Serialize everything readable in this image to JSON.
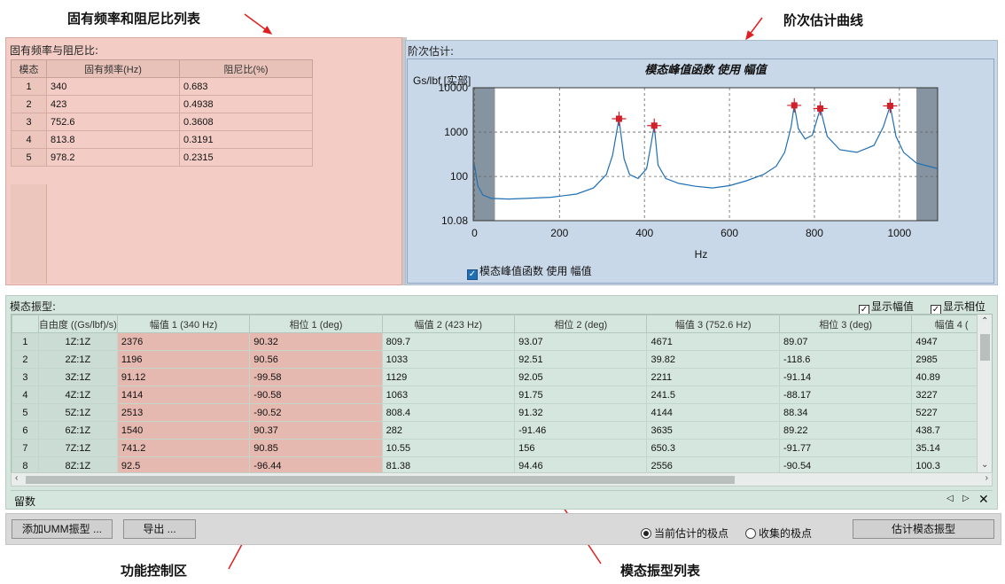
{
  "annotations": {
    "freq_table": "固有频率和阻尼比列表",
    "order_curve": "阶次估计曲线",
    "control_area": "功能控制区",
    "mode_list": "模态振型列表"
  },
  "left_panel": {
    "title": "固有频率与阻尼比:",
    "columns": [
      "模态",
      "固有频率(Hz)",
      "阻尼比(%)"
    ],
    "rows": [
      {
        "idx": "1",
        "freq": "340",
        "damp": "0.683"
      },
      {
        "idx": "2",
        "freq": "423",
        "damp": "0.4938"
      },
      {
        "idx": "3",
        "freq": "752.6",
        "damp": "0.3608"
      },
      {
        "idx": "4",
        "freq": "813.8",
        "damp": "0.3191"
      },
      {
        "idx": "5",
        "freq": "978.2",
        "damp": "0.2315"
      }
    ]
  },
  "right_panel": {
    "title": "阶次估计:",
    "legend_label": "模态峰值函数 使用 幅值"
  },
  "chart_data": {
    "type": "line",
    "title": "模态峰值函数 使用 幅值",
    "xlabel": "Hz",
    "ylabel": "Gs/lbf [实部]",
    "xlim": [
      -3,
      1090
    ],
    "ylim": [
      10.08,
      10000
    ],
    "yscale": "log",
    "x_ticks": [
      "0",
      "200",
      "400",
      "600",
      "800",
      "1000"
    ],
    "y_ticks": [
      "10000",
      "1000",
      "100",
      "10.08"
    ],
    "grid": true,
    "shaded_x_ranges": [
      [
        -3,
        48
      ],
      [
        1040,
        1090
      ]
    ],
    "series": [
      {
        "name": "模态峰值函数 使用 幅值",
        "points": [
          [
            0,
            180
          ],
          [
            8,
            60
          ],
          [
            20,
            38
          ],
          [
            40,
            32
          ],
          [
            80,
            31
          ],
          [
            120,
            32
          ],
          [
            180,
            34
          ],
          [
            240,
            40
          ],
          [
            280,
            55
          ],
          [
            310,
            110
          ],
          [
            325,
            300
          ],
          [
            340,
            2000
          ],
          [
            352,
            250
          ],
          [
            365,
            110
          ],
          [
            385,
            90
          ],
          [
            405,
            150
          ],
          [
            415,
            500
          ],
          [
            423,
            1400
          ],
          [
            432,
            180
          ],
          [
            450,
            90
          ],
          [
            480,
            70
          ],
          [
            520,
            60
          ],
          [
            560,
            55
          ],
          [
            600,
            62
          ],
          [
            640,
            80
          ],
          [
            680,
            110
          ],
          [
            710,
            170
          ],
          [
            730,
            350
          ],
          [
            745,
            1300
          ],
          [
            752.6,
            4000
          ],
          [
            762,
            1200
          ],
          [
            778,
            700
          ],
          [
            795,
            850
          ],
          [
            813.8,
            3400
          ],
          [
            830,
            800
          ],
          [
            860,
            400
          ],
          [
            900,
            350
          ],
          [
            940,
            500
          ],
          [
            962,
            1300
          ],
          [
            978.2,
            3900
          ],
          [
            992,
            800
          ],
          [
            1010,
            350
          ],
          [
            1040,
            200
          ],
          [
            1090,
            150
          ]
        ]
      }
    ],
    "peak_markers": [
      [
        340,
        2000
      ],
      [
        423,
        1400
      ],
      [
        752.6,
        4000
      ],
      [
        813.8,
        3400
      ],
      [
        978.2,
        3900
      ]
    ]
  },
  "mode_panel": {
    "title": "模态振型:",
    "show_amp": "显示幅值",
    "show_phase": "显示相位",
    "columns": [
      "",
      "自由度 ((Gs/lbf)/s)",
      "幅值 1 (340 Hz)",
      "相位 1 (deg)",
      "幅值 2 (423 Hz)",
      "相位 2 (deg)",
      "幅值 3 (752.6 Hz)",
      "相位 3 (deg)",
      "幅值 4 ("
    ],
    "rows": [
      {
        "idx": "1",
        "dof": "1Z:1Z",
        "a1": "2376",
        "p1": "90.32",
        "a2": "809.7",
        "p2": "93.07",
        "a3": "4671",
        "p3": "89.07",
        "a4": "4947"
      },
      {
        "idx": "2",
        "dof": "2Z:1Z",
        "a1": "1196",
        "p1": "90.56",
        "a2": "1033",
        "p2": "92.51",
        "a3": "39.82",
        "p3": "-118.6",
        "a4": "2985"
      },
      {
        "idx": "3",
        "dof": "3Z:1Z",
        "a1": "91.12",
        "p1": "-99.58",
        "a2": "1129",
        "p2": "92.05",
        "a3": "2211",
        "p3": "-91.14",
        "a4": "40.89"
      },
      {
        "idx": "4",
        "dof": "4Z:1Z",
        "a1": "1414",
        "p1": "-90.58",
        "a2": "1063",
        "p2": "91.75",
        "a3": "241.5",
        "p3": "-88.17",
        "a4": "3227"
      },
      {
        "idx": "5",
        "dof": "5Z:1Z",
        "a1": "2513",
        "p1": "-90.52",
        "a2": "808.4",
        "p2": "91.32",
        "a3": "4144",
        "p3": "88.34",
        "a4": "5227"
      },
      {
        "idx": "6",
        "dof": "6Z:1Z",
        "a1": "1540",
        "p1": "90.37",
        "a2": "282",
        "p2": "-91.46",
        "a3": "3635",
        "p3": "89.22",
        "a4": "438.7"
      },
      {
        "idx": "7",
        "dof": "7Z:1Z",
        "a1": "741.2",
        "p1": "90.85",
        "a2": "10.55",
        "p2": "156",
        "a3": "650.3",
        "p3": "-91.77",
        "a4": "35.14"
      },
      {
        "idx": "8",
        "dof": "8Z:1Z",
        "a1": "92.5",
        "p1": "-96.44",
        "a2": "81.38",
        "p2": "94.46",
        "a3": "2556",
        "p3": "-90.54",
        "a4": "100.3"
      }
    ],
    "tab_label": "留数"
  },
  "controls": {
    "add_umm": "添加UMM振型 ...",
    "export": "导出 ...",
    "radio_current": "当前估计的极点",
    "radio_collected": "收集的极点",
    "estimate_btn": "估计模态振型"
  },
  "colors": {
    "freq_panel_bg": "#f3cdc5",
    "chart_panel_bg": "#c9d8e9",
    "mode_panel_bg": "#d5e6de",
    "highlight_col": "#e5b8b0",
    "curve": "#1f6fb4",
    "marker": "#d0202a",
    "arrow": "#e02020"
  }
}
